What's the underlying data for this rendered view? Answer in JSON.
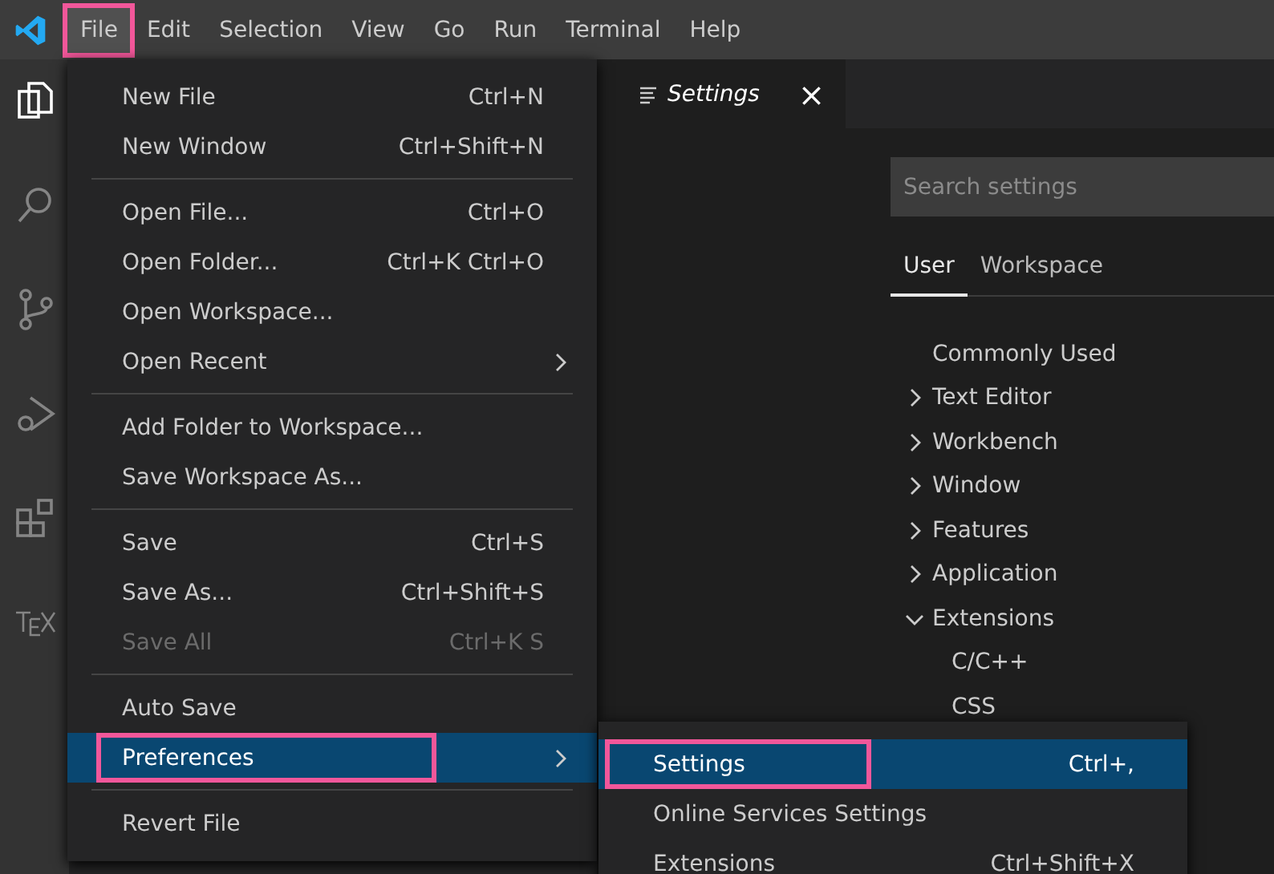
{
  "menu_bar": [
    {
      "label": "File",
      "selected": true,
      "highlighted": true
    },
    {
      "label": "Edit",
      "selected": false,
      "highlighted": false
    },
    {
      "label": "Selection",
      "selected": false,
      "highlighted": false
    },
    {
      "label": "View",
      "selected": false,
      "highlighted": false
    },
    {
      "label": "Go",
      "selected": false,
      "highlighted": false
    },
    {
      "label": "Run",
      "selected": false,
      "highlighted": false
    },
    {
      "label": "Terminal",
      "selected": false,
      "highlighted": false
    },
    {
      "label": "Help",
      "selected": false,
      "highlighted": false
    }
  ],
  "activity_bar": [
    {
      "kind": "explorer",
      "selected": true
    },
    {
      "kind": "search",
      "selected": false
    },
    {
      "kind": "source-control",
      "selected": false
    },
    {
      "kind": "debug",
      "selected": false
    },
    {
      "kind": "extensions",
      "selected": false
    },
    {
      "kind": "tex",
      "selected": false
    }
  ],
  "file_menu": [
    {
      "kind": "item",
      "label": "New File",
      "shortcut": "Ctrl+N",
      "disabled": false,
      "submenu": false,
      "selected": false,
      "highlighted": false
    },
    {
      "kind": "item",
      "label": "New Window",
      "shortcut": "Ctrl+Shift+N",
      "disabled": false,
      "submenu": false,
      "selected": false,
      "highlighted": false
    },
    {
      "kind": "separator"
    },
    {
      "kind": "item",
      "label": "Open File...",
      "shortcut": "Ctrl+O",
      "disabled": false,
      "submenu": false,
      "selected": false,
      "highlighted": false
    },
    {
      "kind": "item",
      "label": "Open Folder...",
      "shortcut": "Ctrl+K Ctrl+O",
      "disabled": false,
      "submenu": false,
      "selected": false,
      "highlighted": false
    },
    {
      "kind": "item",
      "label": "Open Workspace...",
      "disabled": false,
      "submenu": false,
      "selected": false,
      "highlighted": false
    },
    {
      "kind": "item",
      "label": "Open Recent",
      "disabled": false,
      "submenu": true,
      "selected": false,
      "highlighted": false
    },
    {
      "kind": "separator"
    },
    {
      "kind": "item",
      "label": "Add Folder to Workspace...",
      "disabled": false,
      "submenu": false,
      "selected": false,
      "highlighted": false
    },
    {
      "kind": "item",
      "label": "Save Workspace As...",
      "disabled": false,
      "submenu": false,
      "selected": false,
      "highlighted": false
    },
    {
      "kind": "separator"
    },
    {
      "kind": "item",
      "label": "Save",
      "shortcut": "Ctrl+S",
      "disabled": false,
      "submenu": false,
      "selected": false,
      "highlighted": false
    },
    {
      "kind": "item",
      "label": "Save As...",
      "shortcut": "Ctrl+Shift+S",
      "disabled": false,
      "submenu": false,
      "selected": false,
      "highlighted": false
    },
    {
      "kind": "item",
      "label": "Save All",
      "shortcut": "Ctrl+K S",
      "disabled": true,
      "submenu": false,
      "selected": false,
      "highlighted": false
    },
    {
      "kind": "separator"
    },
    {
      "kind": "item",
      "label": "Auto Save",
      "disabled": false,
      "submenu": false,
      "selected": false,
      "highlighted": false
    },
    {
      "kind": "item",
      "label": "Preferences",
      "disabled": false,
      "submenu": true,
      "selected": true,
      "highlighted": true
    },
    {
      "kind": "separator"
    },
    {
      "kind": "item",
      "label": "Revert File",
      "disabled": false,
      "submenu": false,
      "selected": false,
      "highlighted": false
    }
  ],
  "preferences_menu": [
    {
      "label": "Settings",
      "shortcut": "Ctrl+,",
      "selected": true,
      "highlighted": true
    },
    {
      "label": "Online Services Settings",
      "selected": false,
      "highlighted": false
    },
    {
      "label": "Extensions",
      "shortcut": "Ctrl+Shift+X",
      "selected": false,
      "highlighted": false
    }
  ],
  "editor_tab": {
    "title": "Settings",
    "close": "×"
  },
  "settings": {
    "search": {
      "placeholder": "Search settings"
    },
    "scope_tabs": [
      {
        "label": "User",
        "selected": true
      },
      {
        "label": "Workspace",
        "selected": false
      }
    ],
    "tree": [
      {
        "label": "Commonly Used"
      },
      {
        "label": "Text Editor",
        "expanded": false
      },
      {
        "label": "Workbench",
        "expanded": false
      },
      {
        "label": "Window",
        "expanded": false
      },
      {
        "label": "Features",
        "expanded": false
      },
      {
        "label": "Application",
        "expanded": false
      },
      {
        "label": "Extensions",
        "expanded": true,
        "children": [
          {
            "label": "C/C++"
          },
          {
            "label": "CSS"
          }
        ]
      }
    ]
  }
}
